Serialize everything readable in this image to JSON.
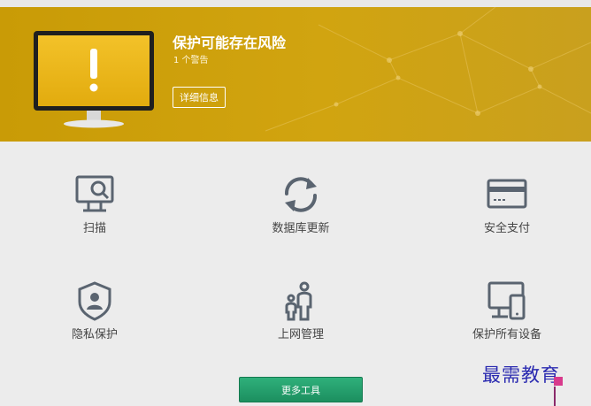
{
  "alert": {
    "title": "保护可能存在风险",
    "subtitle": "1 个警告",
    "details_label": "详细信息"
  },
  "tools": [
    {
      "label": "扫描",
      "icon": "scan-monitor-icon"
    },
    {
      "label": "数据库更新",
      "icon": "refresh-icon"
    },
    {
      "label": "安全支付",
      "icon": "credit-card-icon"
    },
    {
      "label": "隐私保护",
      "icon": "privacy-shield-icon"
    },
    {
      "label": "上网管理",
      "icon": "parental-control-icon"
    },
    {
      "label": "保护所有设备",
      "icon": "devices-icon"
    }
  ],
  "more_tools_label": "更多工具",
  "watermark": "最需教育",
  "colors": {
    "banner": "#c99b06",
    "accent_green": "#1c8f5f",
    "icon_gray": "#5a6470"
  }
}
